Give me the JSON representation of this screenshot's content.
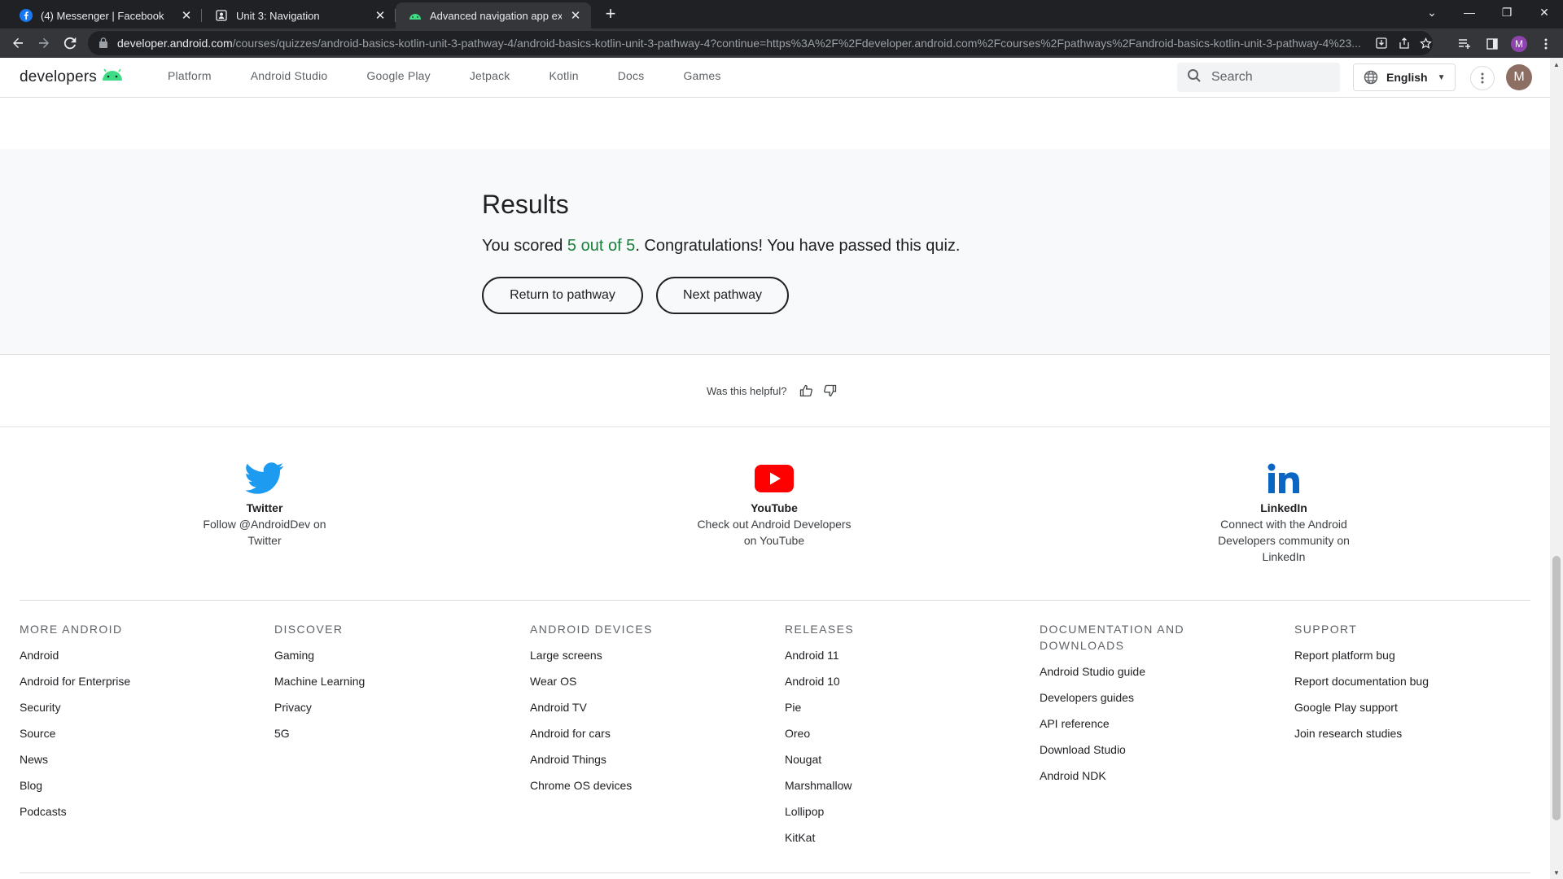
{
  "browser": {
    "tabs": [
      {
        "title": "(4) Messenger | Facebook",
        "icon": "facebook-icon"
      },
      {
        "title": "Unit 3: Navigation",
        "icon": "page-icon"
      },
      {
        "title": "Advanced navigation app examp",
        "icon": "android-icon"
      }
    ],
    "url_host": "developer.android.com",
    "url_path": "/courses/quizzes/android-basics-kotlin-unit-3-pathway-4/android-basics-kotlin-unit-3-pathway-4?continue=https%3A%2F%2Fdeveloper.android.com%2Fcourses%2Fpathways%2Fandroid-basics-kotlin-unit-3-pathway-4%23...",
    "profile_initial": "M"
  },
  "header": {
    "logo_text": "developers",
    "nav": [
      "Platform",
      "Android Studio",
      "Google Play",
      "Jetpack",
      "Kotlin",
      "Docs",
      "Games"
    ],
    "search_placeholder": "Search",
    "language": "English",
    "avatar_initial": "M"
  },
  "results": {
    "title": "Results",
    "text_before": "You scored ",
    "score": "5 out of 5",
    "text_after": ". Congratulations! You have passed this quiz.",
    "return_label": "Return to pathway",
    "next_label": "Next pathway",
    "score_color": "#188038"
  },
  "feedback": {
    "question": "Was this helpful?"
  },
  "social": [
    {
      "title": "Twitter",
      "line1": "Follow @AndroidDev on",
      "line2": "Twitter",
      "line3": "",
      "icon": "twitter-icon"
    },
    {
      "title": "YouTube",
      "line1": "Check out Android Developers",
      "line2": "on YouTube",
      "line3": "",
      "icon": "youtube-icon"
    },
    {
      "title": "LinkedIn",
      "line1": "Connect with the Android",
      "line2": "Developers community on",
      "line3": "LinkedIn",
      "icon": "linkedin-icon"
    }
  ],
  "footer": {
    "columns": [
      {
        "heading": "MORE ANDROID",
        "links": [
          "Android",
          "Android for Enterprise",
          "Security",
          "Source",
          "News",
          "Blog",
          "Podcasts"
        ]
      },
      {
        "heading": "DISCOVER",
        "links": [
          "Gaming",
          "Machine Learning",
          "Privacy",
          "5G"
        ]
      },
      {
        "heading": "ANDROID DEVICES",
        "links": [
          "Large screens",
          "Wear OS",
          "Android TV",
          "Android for cars",
          "Android Things",
          "Chrome OS devices"
        ]
      },
      {
        "heading": "RELEASES",
        "links": [
          "Android 11",
          "Android 10",
          "Pie",
          "Oreo",
          "Nougat",
          "Marshmallow",
          "Lollipop",
          "KitKat"
        ]
      },
      {
        "heading": "DOCUMENTATION AND DOWNLOADS",
        "links": [
          "Android Studio guide",
          "Developers guides",
          "API reference",
          "Download Studio",
          "Android NDK"
        ]
      },
      {
        "heading": "SUPPORT",
        "links": [
          "Report platform bug",
          "Report documentation bug",
          "Google Play support",
          "Join research studies"
        ]
      }
    ]
  }
}
